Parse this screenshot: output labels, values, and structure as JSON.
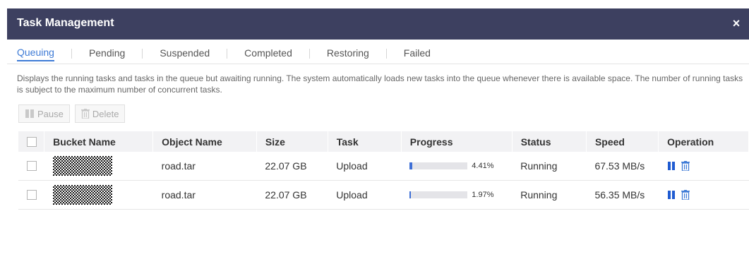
{
  "dialog": {
    "title": "Task Management",
    "close": "×"
  },
  "tabs": [
    {
      "label": "Queuing",
      "active": true
    },
    {
      "label": "Pending",
      "active": false
    },
    {
      "label": "Suspended",
      "active": false
    },
    {
      "label": "Completed",
      "active": false
    },
    {
      "label": "Restoring",
      "active": false
    },
    {
      "label": "Failed",
      "active": false
    }
  ],
  "description": "Displays the running tasks and tasks in the queue but awaiting running. The system automatically loads new tasks into the queue whenever there is available space. The number of running tasks is subject to the maximum number of concurrent tasks.",
  "actions": {
    "pause_label": "Pause",
    "delete_label": "Delete"
  },
  "table": {
    "headers": {
      "bucket": "Bucket Name",
      "object": "Object Name",
      "size": "Size",
      "task": "Task",
      "progress": "Progress",
      "status": "Status",
      "speed": "Speed",
      "operation": "Operation"
    },
    "rows": [
      {
        "object": "road.tar",
        "size": "22.07 GB",
        "task": "Upload",
        "progress": "4.41%",
        "progress_fraction": 0.0441,
        "status": "Running",
        "speed": "67.53 MB/s"
      },
      {
        "object": "road.tar",
        "size": "22.07 GB",
        "task": "Upload",
        "progress": "1.97%",
        "progress_fraction": 0.0197,
        "status": "Running",
        "speed": "56.35 MB/s"
      }
    ]
  },
  "colors": {
    "titlebar": "#3d4060",
    "accent": "#3e7bd6",
    "progress_fill": "#3e6fd6"
  },
  "icons": {
    "pause": "pause-icon",
    "delete": "trash-icon",
    "close": "close-icon"
  }
}
